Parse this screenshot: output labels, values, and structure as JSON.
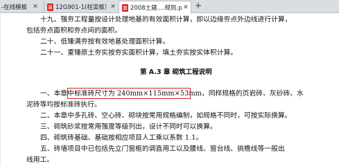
{
  "tabs": [
    {
      "label": "-在线模板",
      "active": false
    },
    {
      "label": "12G901-1(柱梁板）.pdf",
      "active": false
    },
    {
      "label": "2008土建....规则.pdf",
      "active": true
    }
  ],
  "add_tab_symbol": "+",
  "close_symbol": "✕",
  "document": {
    "lines": [
      "十九、强夯工程量按设计处理地基的有效面积计算，即以边缘夯点外边线进行计算，",
      "包括夯点面积和夯点间的面积。",
      "二十、低锤满夯按有效地基处理面积计算。",
      "二十一、重锤原土夯实按夯实面积计算，填土夯实按实体积计算。",
      "一、本章中标准砖尺寸为 240mm×115mm×53mm，同样规格的页岩砖、灰砂砖、水",
      "泥砖等均按标准砖执行。",
      "二、本章中多孔砖、空心砖、砌块按常用规格编制，如规格不同时，可按实际换算。",
      "三、砌筑砂浆按常用强度等级列出，设计不同时可以换算。",
      "四、砌筑砖基础、基础按相应项目人工乘以系数 1.1。",
      "五、砖墙项目中已包括先立门窗框的调直用工以及腰线、窗台线、挑檐线等一般出",
      "线用工。"
    ],
    "heading": "第 A.3 章  砌筑工程说明"
  },
  "colors": {
    "highlight_border": "#d3232c",
    "tabstrip_bg": "#dadde3",
    "pdf_icon": "#d9302a"
  }
}
